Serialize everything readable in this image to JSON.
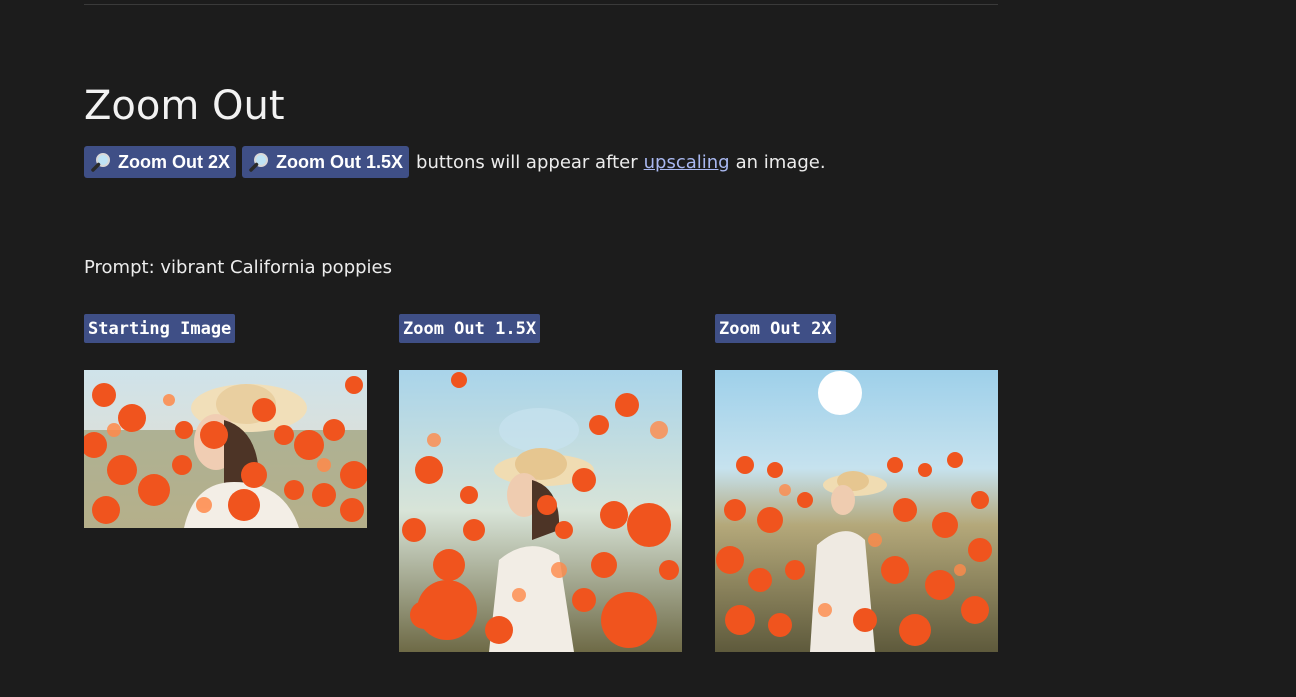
{
  "section": {
    "title": "Zoom Out",
    "buttons": [
      {
        "label": "Zoom Out 2X",
        "icon": "magnifier-icon"
      },
      {
        "label": "Zoom Out 1.5X",
        "icon": "magnifier-icon"
      }
    ],
    "description_before": "buttons will appear after",
    "description_link": "upscaling",
    "description_after": "an image."
  },
  "prompt": "Prompt: vibrant California poppies",
  "images": [
    {
      "label": "Starting Image",
      "alt": "starting-image"
    },
    {
      "label": "Zoom Out 1.5X",
      "alt": "zoom-out-1-5x-image"
    },
    {
      "label": "Zoom Out 2X",
      "alt": "zoom-out-2x-image"
    }
  ],
  "colors": {
    "background": "#1c1c1c",
    "badge": "#3f4f86",
    "link": "#a9b8f0",
    "poppy": "#f0541e",
    "sky": "#a9d4ea"
  }
}
